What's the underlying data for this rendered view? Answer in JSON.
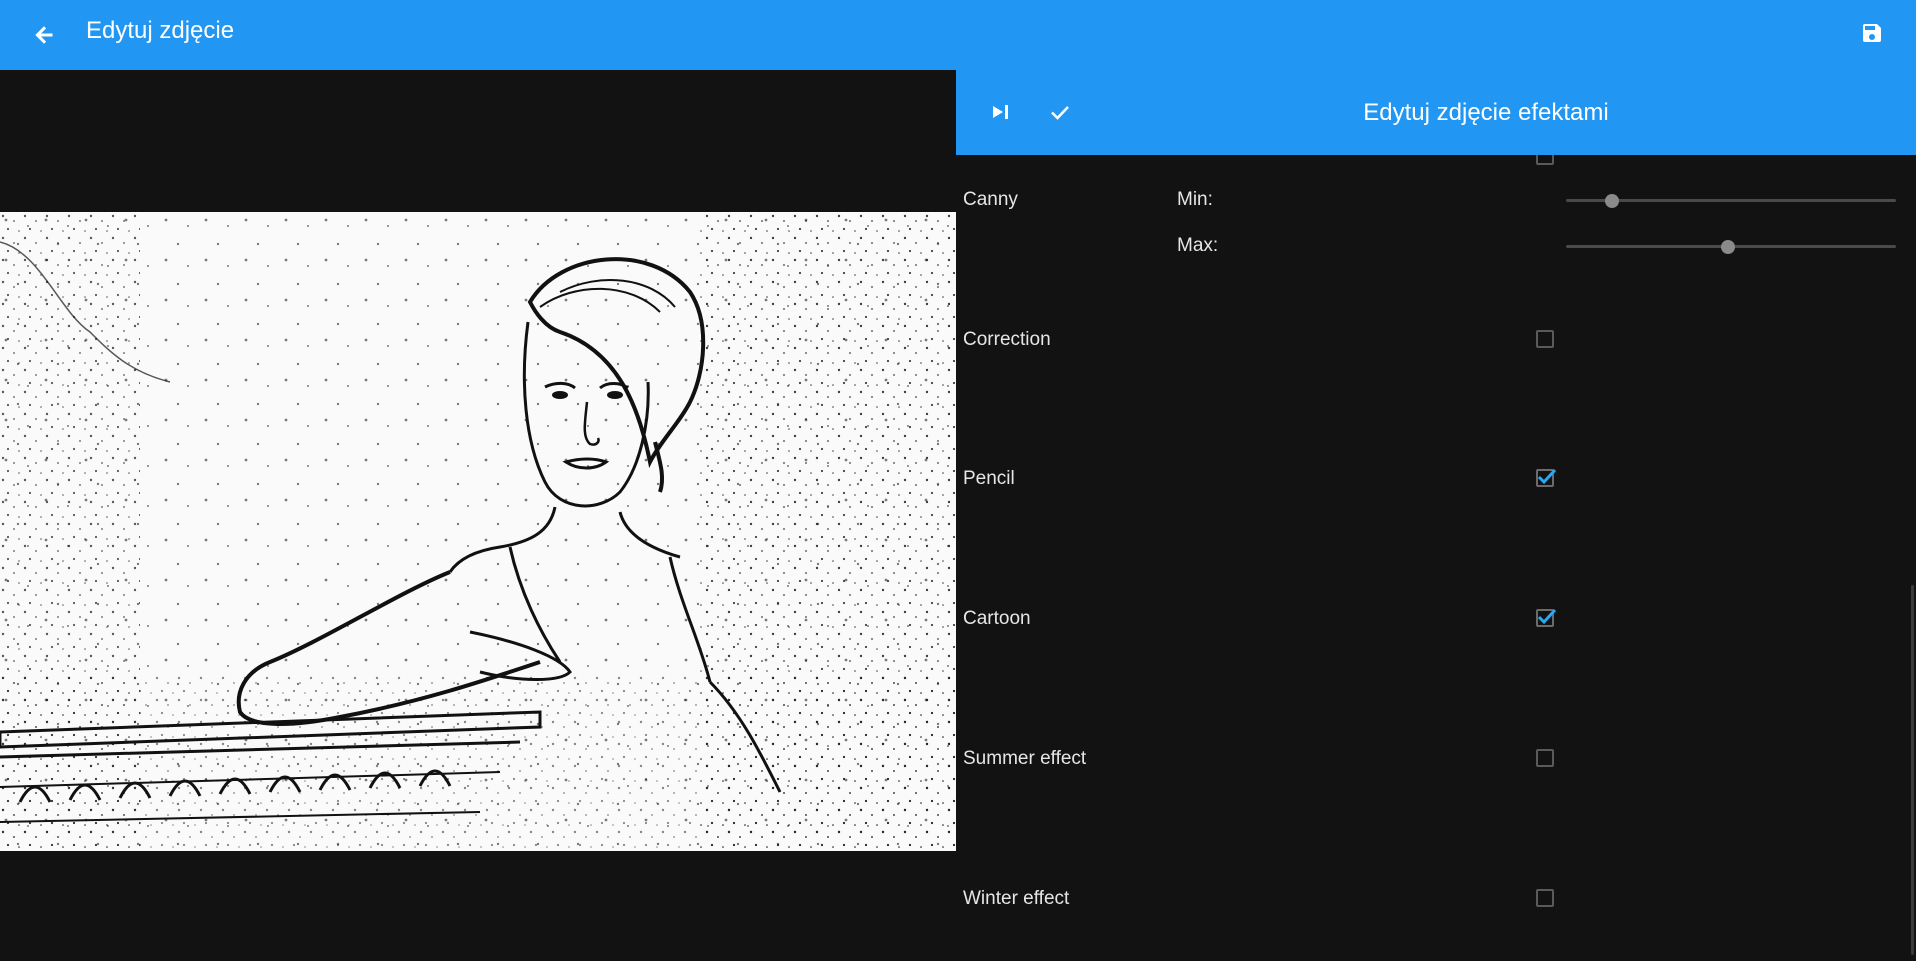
{
  "appbar": {
    "title": "Edytuj zdjęcie",
    "back_icon": "arrow-left-icon",
    "save_icon": "floppy-disk-icon"
  },
  "panel": {
    "title": "Edytuj zdjęcie efektami",
    "compare_icon": "split-compare-icon",
    "apply_icon": "check-icon"
  },
  "effects": {
    "canny": {
      "label": "Canny",
      "min_label": "Min:",
      "max_label": "Max:",
      "min_value": 0.14,
      "max_value": 0.49
    },
    "correction": {
      "label": "Correction",
      "checked": false
    },
    "pencil": {
      "label": "Pencil",
      "checked": true
    },
    "cartoon": {
      "label": "Cartoon",
      "checked": true
    },
    "summer": {
      "label": "Summer effect",
      "checked": false
    },
    "winter": {
      "label": "Winter effect",
      "checked": false
    }
  },
  "colors": {
    "primary": "#2196f3",
    "background": "#121212",
    "checkbox_tick": "#29a8f5"
  }
}
